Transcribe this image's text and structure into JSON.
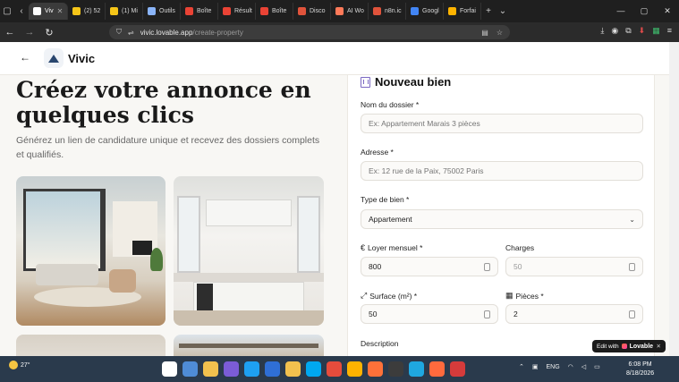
{
  "browser": {
    "tabs": [
      {
        "label": "Viv",
        "color": "#ffffff",
        "active": true
      },
      {
        "label": "(2) 52",
        "color": "#f5c518"
      },
      {
        "label": "(1) Mi",
        "color": "#f5c518"
      },
      {
        "label": "Outils",
        "color": "#8ab4f8"
      },
      {
        "label": "Boîte",
        "color": "#ea4335"
      },
      {
        "label": "Résult",
        "color": "#ea4335"
      },
      {
        "label": "Boîte",
        "color": "#ea4335"
      },
      {
        "label": "Disco",
        "color": "#e0533b"
      },
      {
        "label": "AI Wo",
        "color": "#ff7a59"
      },
      {
        "label": "n8n.ic",
        "color": "#e0533b"
      },
      {
        "label": "Googl",
        "color": "#4285f4"
      },
      {
        "label": "Forfai",
        "color": "#ffb400"
      }
    ],
    "new_tab": "+",
    "url_host": "vivic.lovable.app",
    "url_path": "/create-property"
  },
  "app": {
    "brand": "Vivic"
  },
  "hero": {
    "title": "Créez votre annonce en quelques clics",
    "subtitle": "Générez un lien de candidature unique et recevez des dossiers complets et qualifiés."
  },
  "form": {
    "title": "Nouveau bien",
    "dossier_label": "Nom du dossier *",
    "dossier_placeholder": "Ex: Appartement Marais 3 pièces",
    "adresse_label": "Adresse *",
    "adresse_placeholder": "Ex: 12 rue de la Paix, 75002 Paris",
    "type_label": "Type de bien *",
    "type_value": "Appartement",
    "loyer_label": "Loyer mensuel *",
    "loyer_value": "800",
    "charges_label": "Charges",
    "charges_placeholder": "50",
    "surface_label": "Surface (m²) *",
    "surface_value": "50",
    "pieces_label": "Pièces *",
    "pieces_value": "2",
    "description_label": "Description"
  },
  "badge": {
    "edit_with": "Edit with",
    "brand": "Lovable"
  },
  "taskbar": {
    "temperature": "27°",
    "language": "ENG",
    "time": "6:08 PM",
    "date": "8/18/2026",
    "app_colors": [
      "#ffffff",
      "#4f8cd6",
      "#f2c14e",
      "#7b5cd6",
      "#1ea0f2",
      "#2f6fd6",
      "#f2c14e",
      "#00a8f0",
      "#e74c3c",
      "#ffb300",
      "#ff7139",
      "#3c3c3c",
      "#1fa8e0",
      "#ff6a3d",
      "#d63b3b"
    ]
  }
}
